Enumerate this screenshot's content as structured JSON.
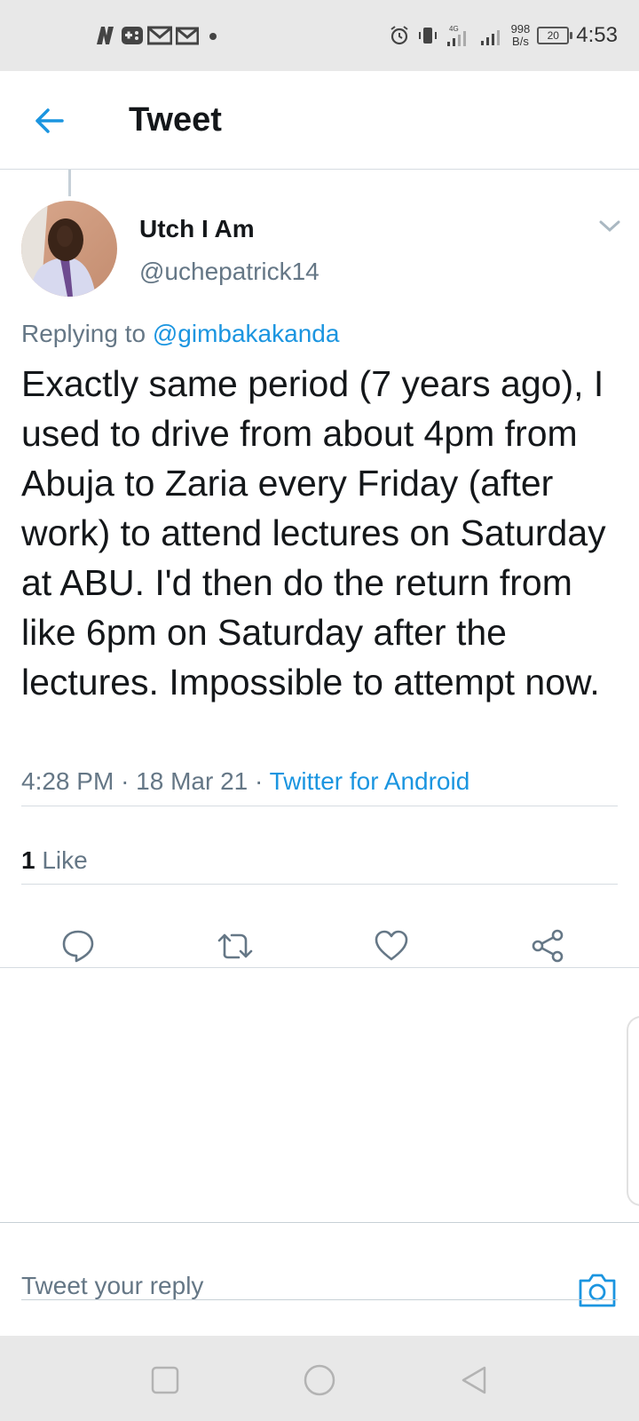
{
  "status_bar": {
    "time": "4:53",
    "net_speed_value": "998",
    "net_speed_unit": "B/s",
    "network_type": "4G",
    "battery": "20",
    "notification_icons": [
      "netflix-icon",
      "game-icon",
      "gmail-icon",
      "gmail-icon",
      "dot-icon"
    ],
    "status_icons": [
      "alarm-icon",
      "vibrate-icon",
      "signal-icon",
      "signal-icon",
      "battery-icon"
    ]
  },
  "header": {
    "title": "Tweet"
  },
  "tweet": {
    "display_name": "Utch I Am",
    "handle": "@uchepatrick14",
    "replying_prefix": "Replying to",
    "replying_to": "@gimbakakanda",
    "text": "Exactly same period (7 years ago), I used to drive from about 4pm from Abuja to Zaria every Friday (after work) to attend lectures on Saturday at ABU. I'd then do the return from like 6pm on Saturday after the lectures. Impossible to attempt now.",
    "time": "4:28 PM",
    "date": "18 Mar 21",
    "separator": "·",
    "source": "Twitter for Android",
    "likes_count": "1",
    "likes_label": "Like"
  },
  "reply": {
    "placeholder": "Tweet your reply"
  },
  "colors": {
    "accent": "#1b95e0",
    "secondary_text": "#657786",
    "divider": "#d6dce1",
    "system_bar": "#e8e8e8"
  }
}
